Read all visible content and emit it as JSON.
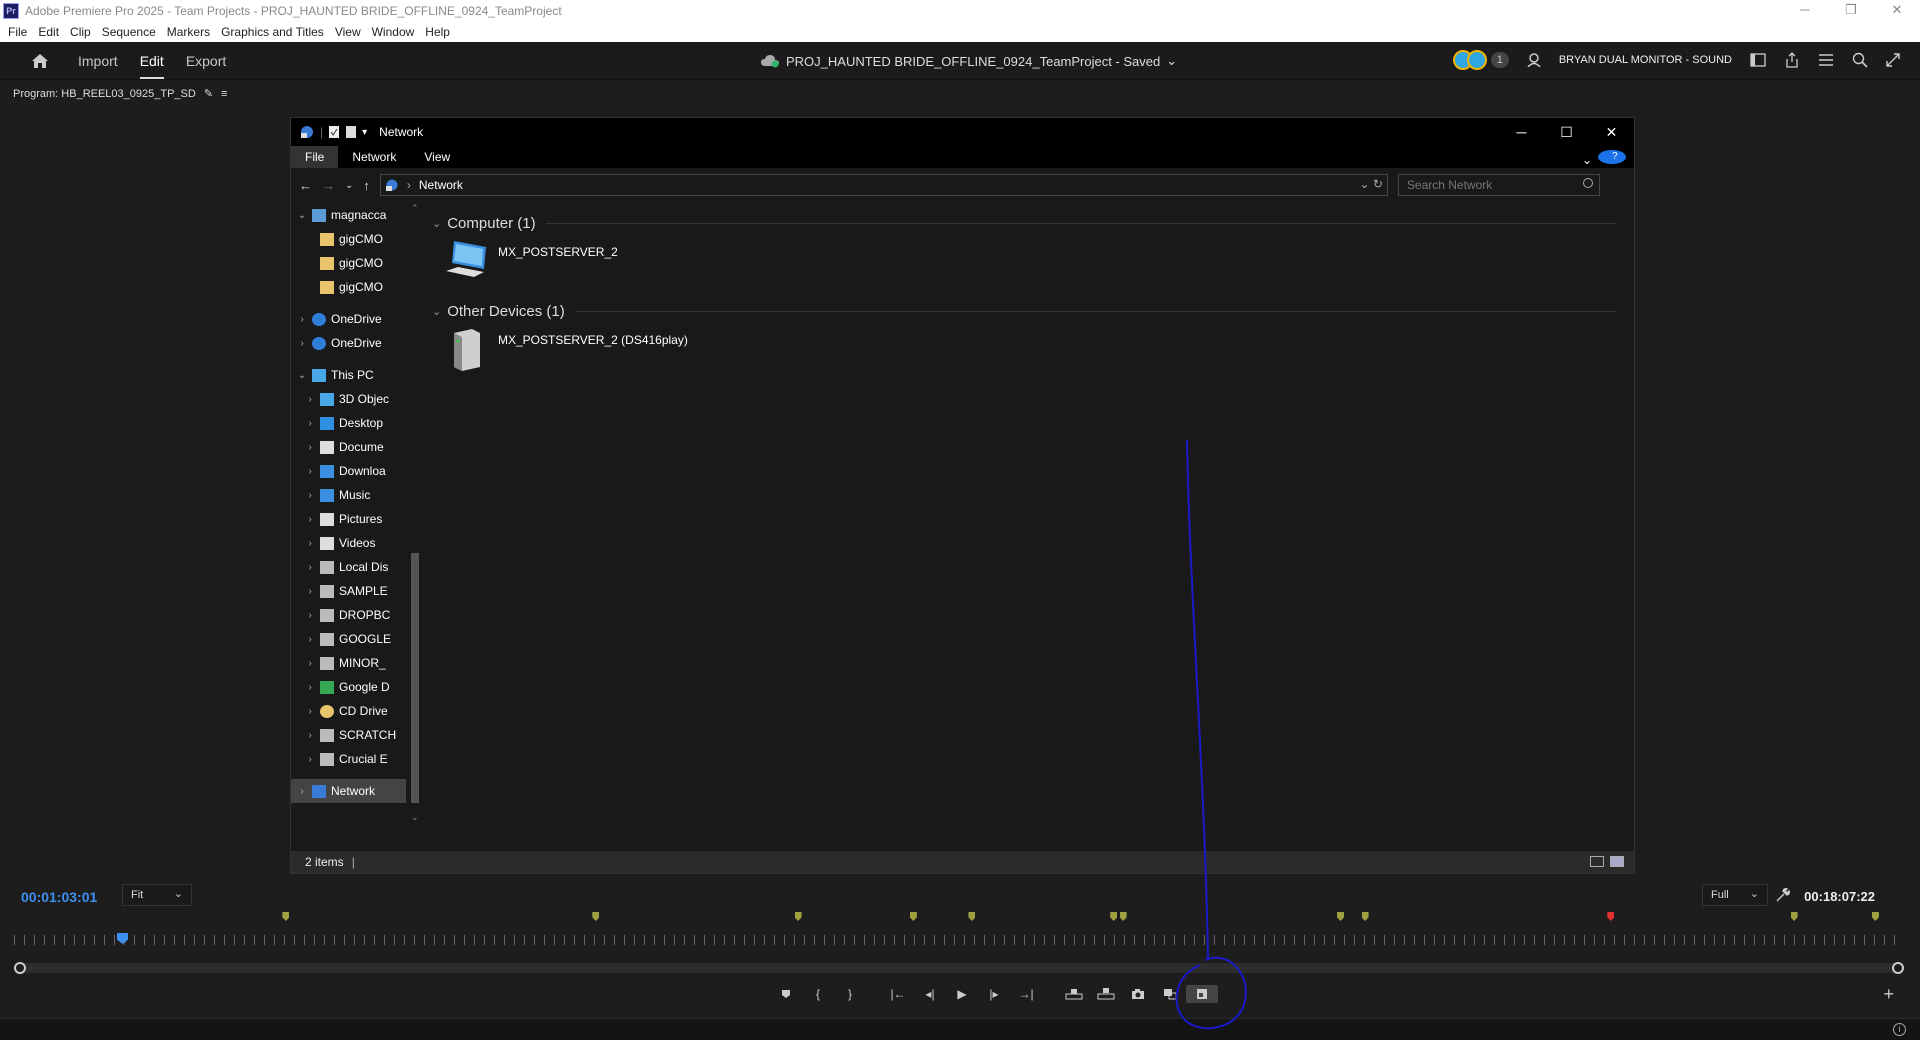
{
  "window": {
    "title": "Adobe Premiere Pro 2025 - Team Projects - PROJ_HAUNTED BRIDE_OFFLINE_0924_TeamProject",
    "logo_text": "Pr"
  },
  "menu": [
    "File",
    "Edit",
    "Clip",
    "Sequence",
    "Markers",
    "Graphics and Titles",
    "View",
    "Window",
    "Help"
  ],
  "header": {
    "tabs": [
      "Import",
      "Edit",
      "Export"
    ],
    "active_tab": "Edit",
    "project_title": "PROJ_HAUNTED BRIDE_OFFLINE_0924_TeamProject - Saved",
    "collaborator_count": "1",
    "workspace": "BRYAN DUAL MONITOR - SOUND"
  },
  "program_panel": {
    "label": "Program: HB_REEL03_0925_TP_SD",
    "timecode_current": "00:01:03:01",
    "timecode_duration": "00:18:07:22",
    "zoom_select": "Fit",
    "quality_select": "Full",
    "markers": [
      {
        "pos": 0.142,
        "color": "#a0a040"
      },
      {
        "pos": 0.306,
        "color": "#a0a040"
      },
      {
        "pos": 0.413,
        "color": "#a0a040"
      },
      {
        "pos": 0.474,
        "color": "#a0a040"
      },
      {
        "pos": 0.505,
        "color": "#a0a040"
      },
      {
        "pos": 0.58,
        "color": "#a0a040"
      },
      {
        "pos": 0.585,
        "color": "#a0a040"
      },
      {
        "pos": 0.7,
        "color": "#a0a040"
      },
      {
        "pos": 0.713,
        "color": "#a0a040"
      },
      {
        "pos": 0.843,
        "color": "#e03030"
      },
      {
        "pos": 0.94,
        "color": "#a0a040"
      },
      {
        "pos": 0.983,
        "color": "#a0a040"
      }
    ]
  },
  "explorer": {
    "title": "Network",
    "ribbon": [
      "File",
      "Network",
      "View"
    ],
    "address": "Network",
    "search_placeholder": "Search Network",
    "nav_items": [
      {
        "label": "magnacca",
        "level": 0,
        "expanded": true,
        "icon": "building-icon"
      },
      {
        "label": "gigCMO",
        "level": 1,
        "icon": "folder-icon"
      },
      {
        "label": "gigCMO",
        "level": 1,
        "icon": "folder-icon"
      },
      {
        "label": "gigCMO",
        "level": 1,
        "icon": "folder-icon"
      },
      {
        "label": "OneDrive",
        "level": 0,
        "icon": "cloud-icon"
      },
      {
        "label": "OneDrive",
        "level": 0,
        "icon": "cloud-icon"
      },
      {
        "label": "This PC",
        "level": 0,
        "expanded": true,
        "icon": "pc-icon"
      },
      {
        "label": "3D Objec",
        "level": 1,
        "icon": "cube-icon"
      },
      {
        "label": "Desktop",
        "level": 1,
        "icon": "desktop-icon"
      },
      {
        "label": "Docume",
        "level": 1,
        "icon": "document-icon"
      },
      {
        "label": "Downloa",
        "level": 1,
        "icon": "download-icon"
      },
      {
        "label": "Music",
        "level": 1,
        "icon": "music-icon"
      },
      {
        "label": "Pictures",
        "level": 1,
        "icon": "pictures-icon"
      },
      {
        "label": "Videos",
        "level": 1,
        "icon": "videos-icon"
      },
      {
        "label": "Local Dis",
        "level": 1,
        "icon": "drive-icon"
      },
      {
        "label": "SAMPLE",
        "level": 1,
        "icon": "drive-icon"
      },
      {
        "label": "DROPBC",
        "level": 1,
        "icon": "drive-icon"
      },
      {
        "label": "GOOGLE",
        "level": 1,
        "icon": "drive-icon"
      },
      {
        "label": "MINOR_",
        "level": 1,
        "icon": "drive-icon"
      },
      {
        "label": "Google D",
        "level": 1,
        "icon": "google-drive-icon"
      },
      {
        "label": "CD Drive",
        "level": 1,
        "icon": "cd-icon"
      },
      {
        "label": "SCRATCH",
        "level": 1,
        "icon": "drive-icon"
      },
      {
        "label": "Crucial E",
        "level": 1,
        "icon": "drive-icon"
      },
      {
        "label": "Network",
        "level": 0,
        "selected": true,
        "icon": "network-icon"
      }
    ],
    "groups": [
      {
        "title": "Computer (1)",
        "items": [
          {
            "label": "MX_POSTSERVER_2",
            "icon": "computer-icon"
          }
        ]
      },
      {
        "title": "Other Devices (1)",
        "items": [
          {
            "label": "MX_POSTSERVER_2 (DS416play)",
            "icon": "nas-icon"
          }
        ]
      }
    ],
    "status": "2 items"
  },
  "colors": {
    "accent_blue": "#3d8ef0",
    "annotation": "#1a1ac8"
  }
}
